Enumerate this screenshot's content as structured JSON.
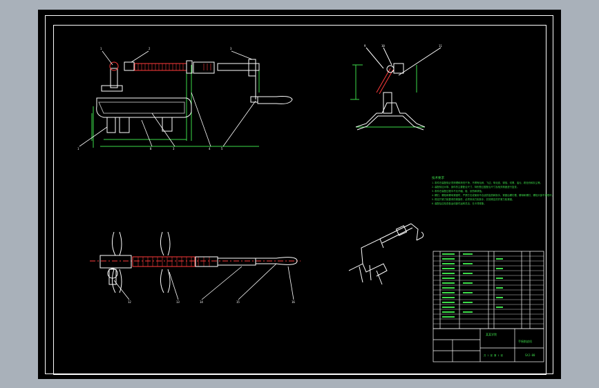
{
  "drawing": {
    "balloons_front": [
      "1",
      "2",
      "3"
    ],
    "balloons_front_bottom": [
      "1",
      "8",
      "3",
      "4",
      "5"
    ],
    "balloons_side": [
      "9",
      "10",
      "11"
    ],
    "balloons_top": [
      "12",
      "13",
      "14",
      "15",
      "16"
    ],
    "tech_title": "技术要求",
    "tech_lines": [
      "1.零件在装配前必须清理和清洗干净，不得有毛刺、飞边、氧化皮、锈蚀、切屑、油污、着色剂和灰尘等。",
      "2.装配前应对零、部件的主要配合尺寸，特别是过盈配合尺寸及相关精度进行复查。",
      "3.零件在装配过程中不允许磕、碰、划伤和锈蚀。",
      "4.螺钉、螺栓和螺母紧固时，严禁打击或使用不合适的旋具和扳手。紧固后螺钉槽、螺母和螺钉、螺栓头部不得损坏。",
      "5.规定拧紧力矩要求的紧固件，必须采用力矩扳手，并按规定的拧紧力矩紧固。",
      "6.装配后应检查各运动部件运转灵活，无卡滞现象。"
    ],
    "title_block": {
      "company": "某某学院",
      "drawing_name": "手摇削皮机",
      "drawing_no": "SXJ-00",
      "scale_row": "共 1 张   第 1 张"
    }
  }
}
